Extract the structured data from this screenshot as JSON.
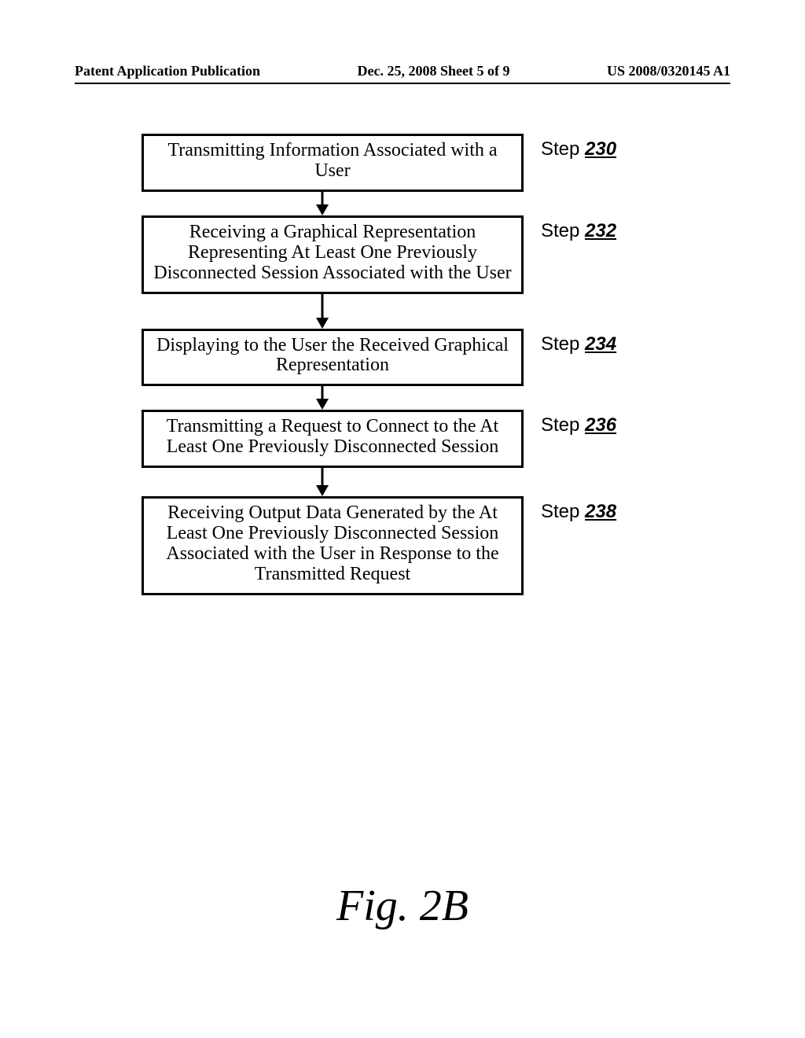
{
  "header": {
    "left": "Patent Application Publication",
    "center": "Dec. 25, 2008  Sheet 5 of 9",
    "right": "US 2008/0320145 A1"
  },
  "flow": {
    "steps": [
      {
        "text": "Transmitting Information Associated with a User",
        "label_prefix": "Step ",
        "label_num": "230"
      },
      {
        "text": "Receiving a Graphical Representation Representing At Least One Previously Disconnected Session Associated with the User",
        "label_prefix": "Step ",
        "label_num": "232"
      },
      {
        "text": "Displaying to the User the Received Graphical Representation",
        "label_prefix": "Step ",
        "label_num": "234"
      },
      {
        "text": "Transmitting a Request to Connect to the At Least One Previously Disconnected Session",
        "label_prefix": "Step ",
        "label_num": "236"
      },
      {
        "text": "Receiving Output Data Generated by the At Least One Previously Disconnected Session Associated with the User in Response to the Transmitted Request",
        "label_prefix": "Step ",
        "label_num": "238"
      }
    ]
  },
  "caption": "Fig. 2B"
}
